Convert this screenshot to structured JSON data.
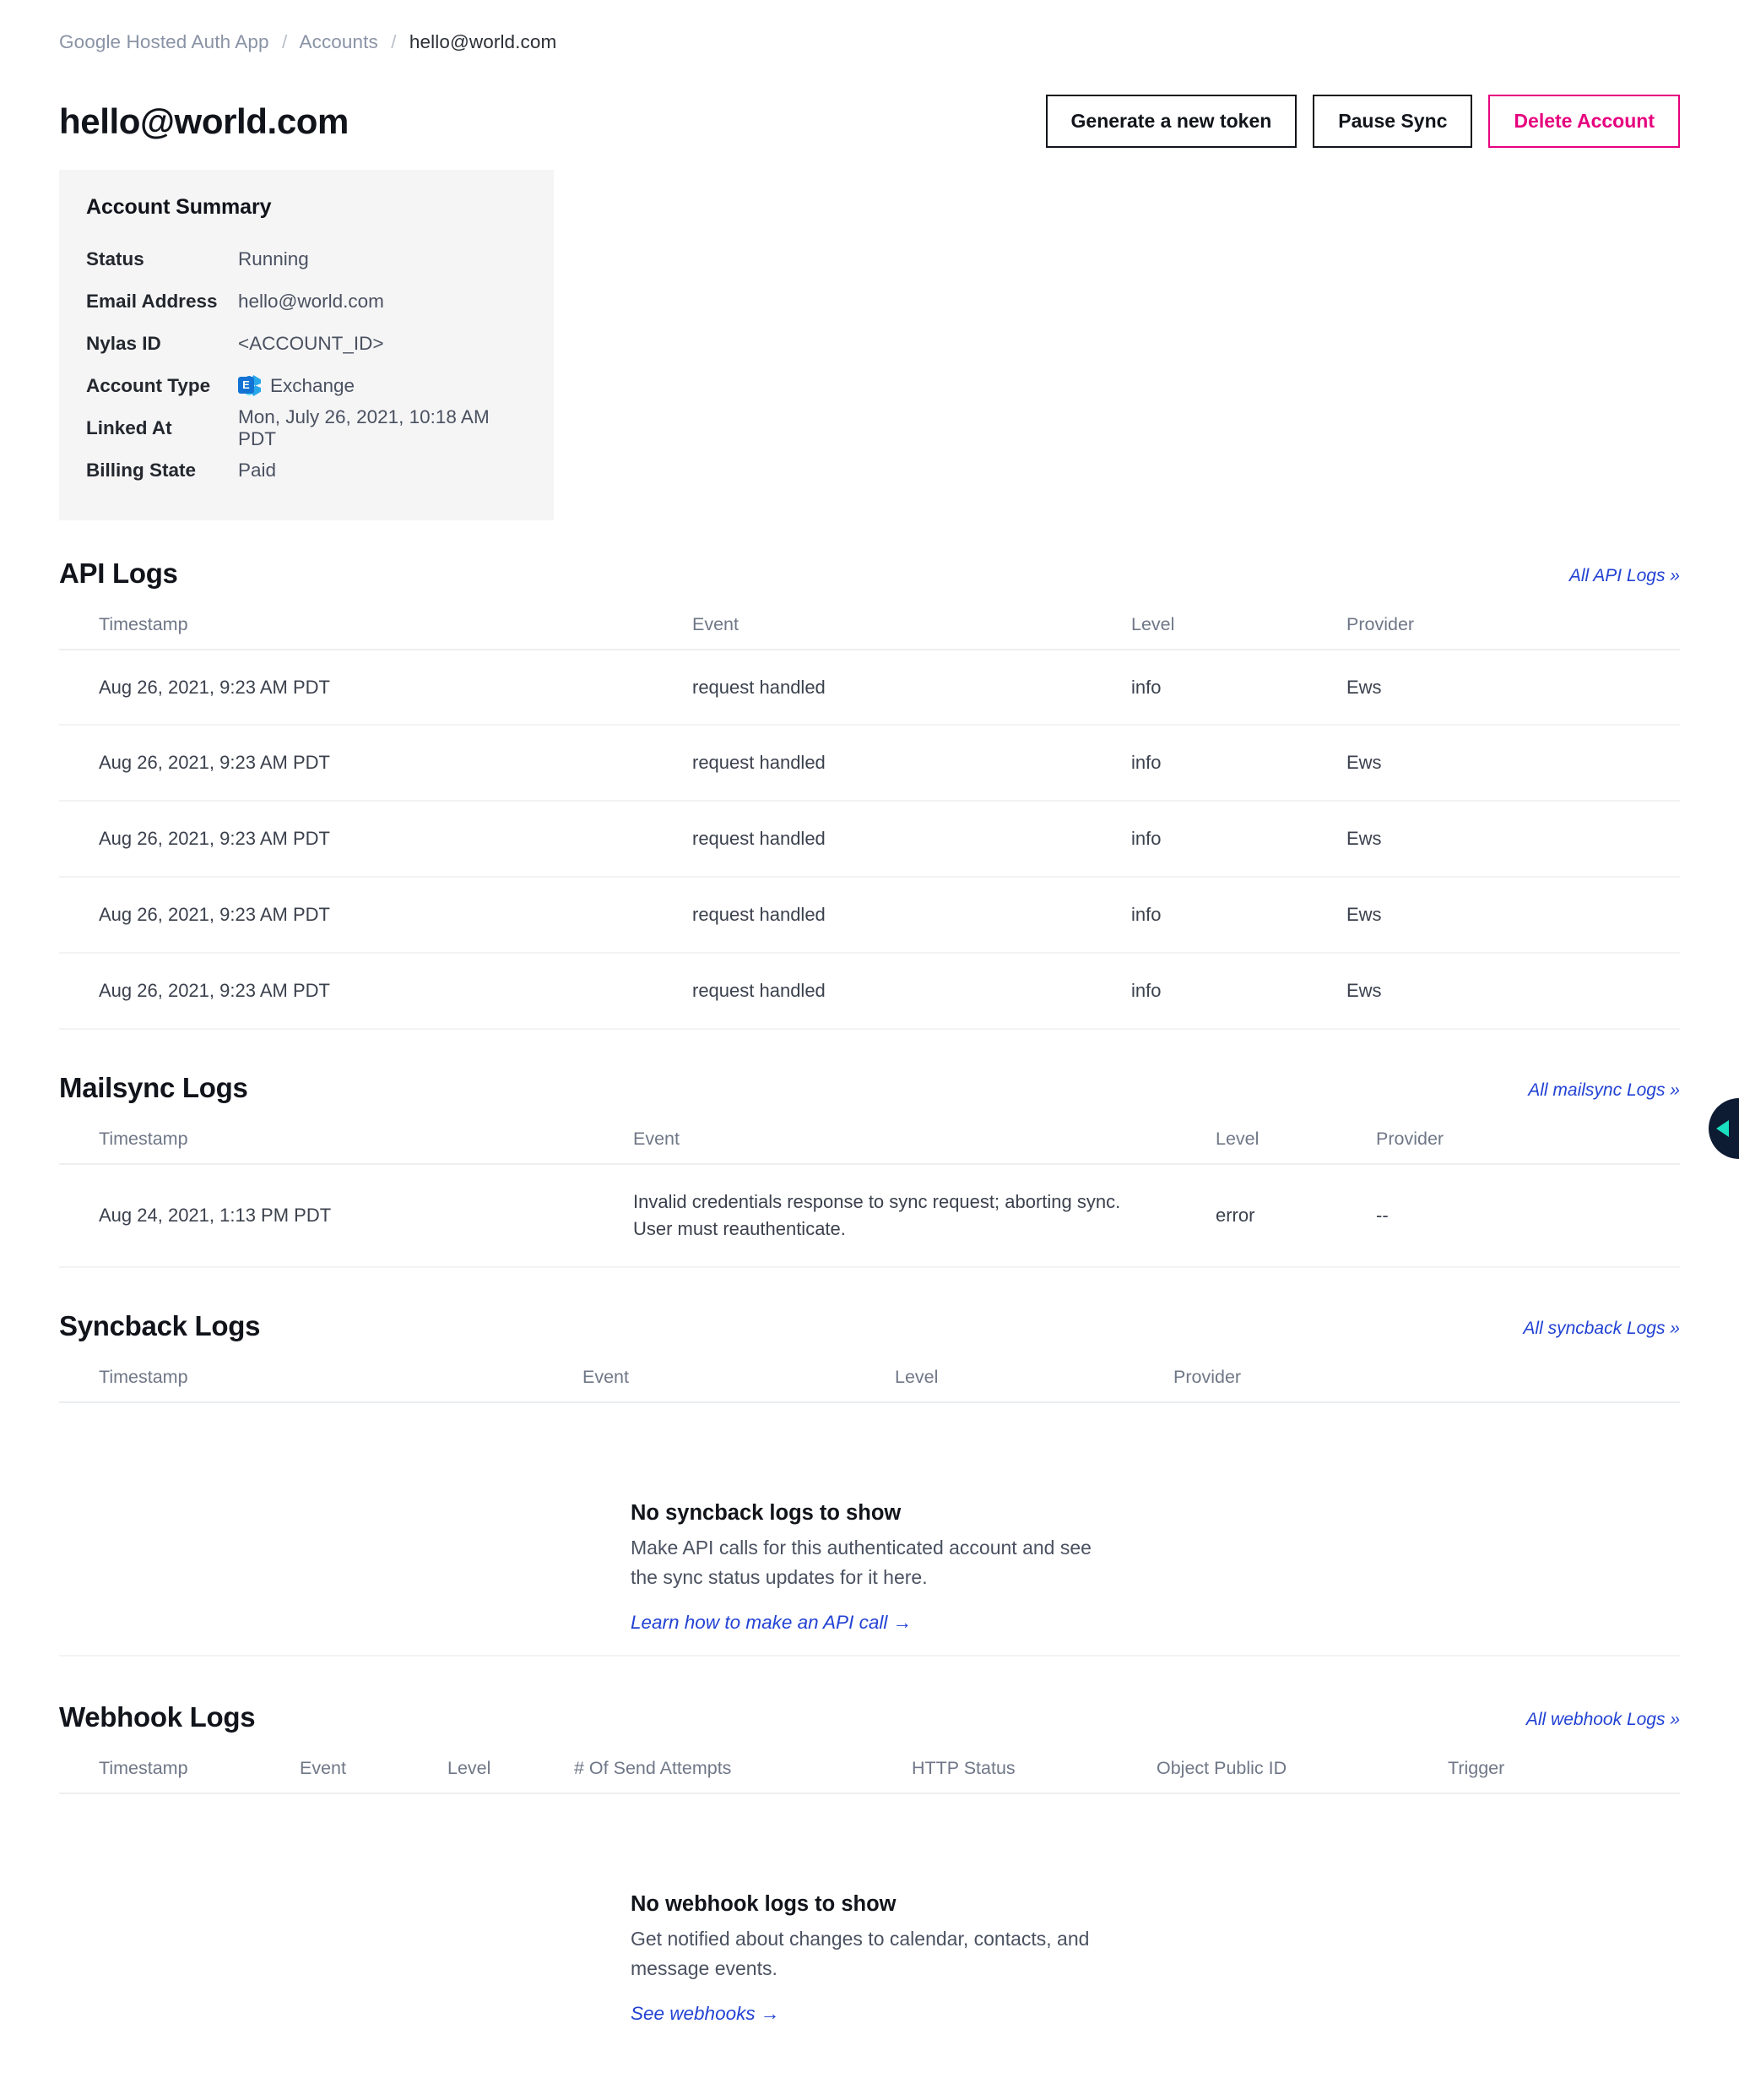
{
  "breadcrumb": {
    "app": "Google Hosted Auth App",
    "section": "Accounts",
    "current": "hello@world.com",
    "separator": "/"
  },
  "header": {
    "title": "hello@world.com",
    "buttons": {
      "generate_token": "Generate a new token",
      "pause_sync": "Pause Sync",
      "delete_account": "Delete Account"
    },
    "accent_danger": "#e6007e"
  },
  "account_summary": {
    "title": "Account Summary",
    "rows": [
      {
        "key": "Status",
        "value": "Running"
      },
      {
        "key": "Email Address",
        "value": "hello@world.com"
      },
      {
        "key": "Nylas ID",
        "value": "<ACCOUNT_ID>"
      },
      {
        "key": "Account Type",
        "value": "Exchange",
        "icon": "exchange-icon",
        "icon_letter": "E"
      },
      {
        "key": "Linked At",
        "value": "Mon, July 26, 2021, 10:18 AM PDT"
      },
      {
        "key": "Billing State",
        "value": "Paid"
      }
    ]
  },
  "api_logs": {
    "title": "API Logs",
    "link": "All API Logs »",
    "columns": [
      "Timestamp",
      "Event",
      "Level",
      "Provider"
    ],
    "rows": [
      [
        "Aug 26, 2021, 9:23 AM PDT",
        "request handled",
        "info",
        "Ews"
      ],
      [
        "Aug 26, 2021, 9:23 AM PDT",
        "request handled",
        "info",
        "Ews"
      ],
      [
        "Aug 26, 2021, 9:23 AM PDT",
        "request handled",
        "info",
        "Ews"
      ],
      [
        "Aug 26, 2021, 9:23 AM PDT",
        "request handled",
        "info",
        "Ews"
      ],
      [
        "Aug 26, 2021, 9:23 AM PDT",
        "request handled",
        "info",
        "Ews"
      ]
    ]
  },
  "mailsync_logs": {
    "title": "Mailsync Logs",
    "link": "All mailsync Logs »",
    "columns": [
      "Timestamp",
      "Event",
      "Level",
      "Provider"
    ],
    "rows": [
      [
        "Aug 24, 2021, 1:13 PM PDT",
        "Invalid credentials response to sync request; aborting sync. User must reauthenticate.",
        "error",
        "--"
      ]
    ]
  },
  "syncback_logs": {
    "title": "Syncback Logs",
    "link": "All syncback Logs »",
    "columns": [
      "Timestamp",
      "Event",
      "Level",
      "Provider"
    ],
    "rows": [],
    "empty": {
      "title": "No syncback logs to show",
      "description": "Make API calls for this authenticated account and see the sync status updates for it here.",
      "link": "Learn how to make an API call  →"
    }
  },
  "webhook_logs": {
    "title": "Webhook Logs",
    "link": "All webhook Logs »",
    "columns": [
      "Timestamp",
      "Event",
      "Level",
      "# Of Send Attempts",
      "HTTP Status",
      "Object Public ID",
      "Trigger"
    ],
    "rows": [],
    "empty": {
      "title": "No webhook logs to show",
      "description": "Get notified about changes to calendar, contacts, and message events.",
      "link": "See webhooks  →"
    }
  },
  "panel_toggle": {
    "name": "expand-side-panel",
    "background": "#0d1b33",
    "arrow_color": "#19e0c0"
  }
}
